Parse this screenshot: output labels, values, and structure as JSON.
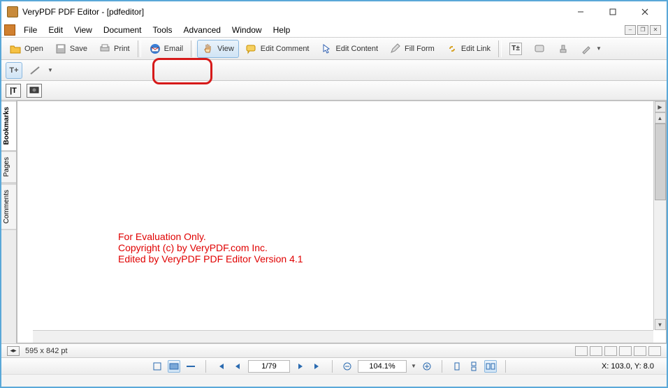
{
  "title": "VeryPDF PDF Editor - [pdfeditor]",
  "menu": [
    "File",
    "Edit",
    "View",
    "Document",
    "Tools",
    "Advanced",
    "Window",
    "Help"
  ],
  "toolbar1": {
    "open": "Open",
    "save": "Save",
    "print": "Print",
    "email": "Email",
    "view": "View",
    "edit_comment": "Edit Comment",
    "edit_content": "Edit Content",
    "fill_form": "Fill Form",
    "edit_link": "Edit Link"
  },
  "side_tabs": {
    "bookmarks": "Bookmarks",
    "pages": "Pages",
    "comments": "Comments"
  },
  "eval_lines": {
    "l1": "For Evaluation Only.",
    "l2": "Copyright (c) by VeryPDF.com Inc.",
    "l3": "Edited by VeryPDF PDF Editor Version 4.1"
  },
  "dims": "595 x 842 pt",
  "nav": {
    "page": "1/79",
    "zoom": "104.1%"
  },
  "coord": "X: 103.0, Y: 8.0"
}
